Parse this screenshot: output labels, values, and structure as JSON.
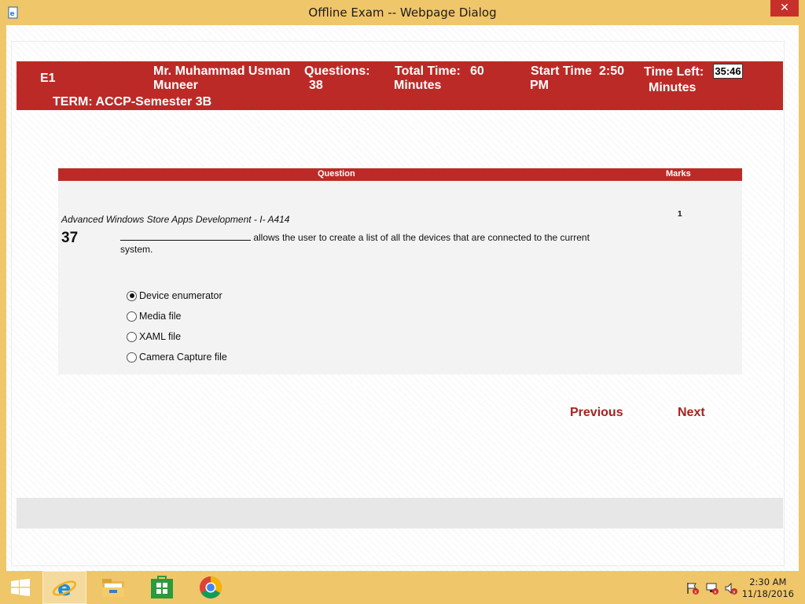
{
  "window": {
    "title": "Offline Exam -- Webpage Dialog",
    "close_glyph": "✕"
  },
  "header": {
    "code": "E1",
    "name_line1": "Mr. Muhammad Usman",
    "name_line2": "Muneer",
    "questions_label": "Questions:",
    "questions_value": "38",
    "total_time_label": "Total Time:",
    "total_time_value": "60",
    "total_time_unit": "Minutes",
    "start_time_label": "Start Time",
    "start_time_value": "2:50",
    "start_time_ampm": "PM",
    "time_left_label": "Time Left:",
    "time_left_unit": "Minutes",
    "timer": "35:46",
    "term": "TERM: ACCP-Semester 3B"
  },
  "question_table": {
    "col_question": "Question",
    "col_marks": "Marks",
    "subject": "Advanced Windows Store Apps Development - I- A414",
    "marks": "1",
    "number": "37",
    "text_after_blank": " allows the user to create a list of all the devices that are connected to the current system.",
    "options": [
      {
        "label": "Device enumerator",
        "selected": true
      },
      {
        "label": "Media file",
        "selected": false
      },
      {
        "label": "XAML file",
        "selected": false
      },
      {
        "label": "Camera Capture file",
        "selected": false
      }
    ]
  },
  "nav": {
    "previous": "Previous",
    "next": "Next"
  },
  "taskbar": {
    "apps": [
      "start-icon",
      "internet-explorer-icon",
      "file-explorer-icon",
      "store-icon",
      "chrome-icon"
    ],
    "clock_time": "2:30 AM",
    "clock_date": "11/18/2016"
  },
  "colors": {
    "accent_red": "#bc2a27",
    "link_red": "#a52320",
    "taskbar": "#f0c66a"
  }
}
